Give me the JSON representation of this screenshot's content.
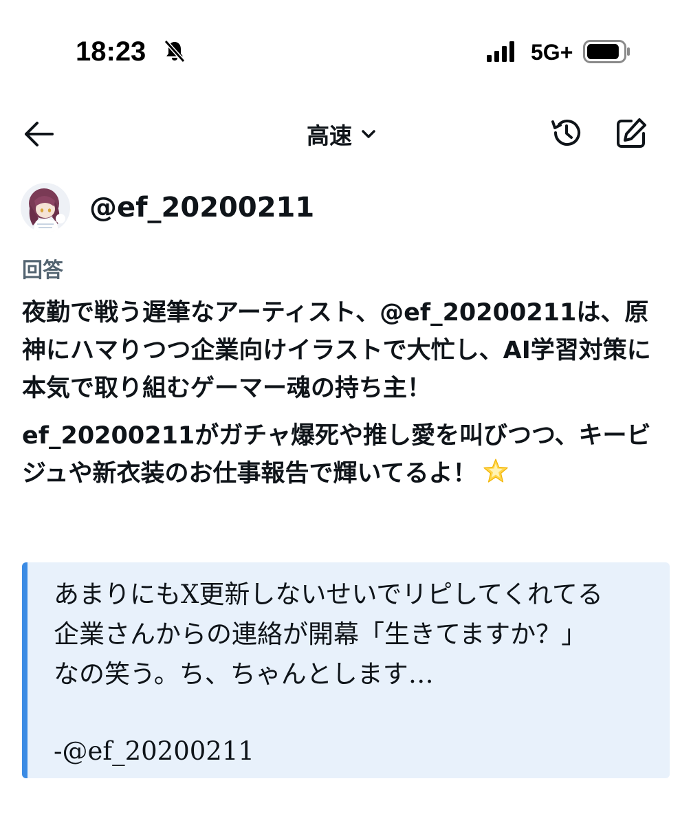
{
  "status_bar": {
    "time": "18:23",
    "network": "5G+",
    "icons": {
      "bell": "bell-slash-icon",
      "signal": "signal-bars-icon",
      "battery": "battery-icon"
    },
    "battery_level": 0.9
  },
  "header": {
    "back_icon": "arrow-left-icon",
    "mode_label": "高速",
    "mode_icon": "chevron-down-icon",
    "history_icon": "history-icon",
    "compose_icon": "compose-icon"
  },
  "profile": {
    "handle": "@ef_20200211",
    "avatar_icon": "avatar-image"
  },
  "answer": {
    "label": "回答",
    "paragraph_1": "夜勤で戦う遅筆なアーティスト、@ef_20200211は、原神にハマりつつ企業向けイラストで大忙し、AI学習対策に本気で取り組むゲーマー魂の持ち主！",
    "paragraph_2": "ef_20200211がガチャ爆死や推し愛を叫びつつ、キービジュや新衣装のお仕事報告で輝いてるよ！",
    "emoji_icon": "glowing-star-icon"
  },
  "quote": {
    "text": "あまりにもX更新しないせいでリピしてくれてる企業さんからの連絡が開幕「生きてますか？」なの笑う。ち、ちゃんとします…",
    "author": "-@ef_20200211"
  },
  "colors": {
    "text_primary": "#0f1419",
    "text_secondary": "#536471",
    "quote_background": "#e8f1fb",
    "quote_accent": "#3b8be4"
  }
}
